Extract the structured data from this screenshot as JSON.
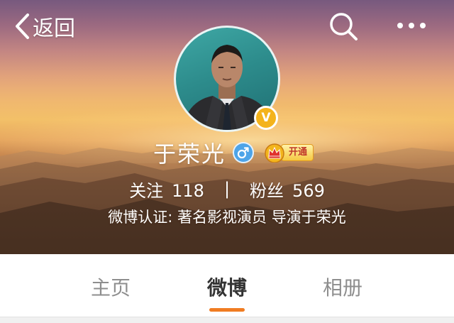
{
  "nav": {
    "back_label": "返回",
    "back_icon": "chevron-left-icon",
    "search_icon": "search-icon",
    "more_icon": "more-dots-icon"
  },
  "profile": {
    "name": "于荣光",
    "verified_mark": "V",
    "gender_icon": "male-icon",
    "vip_open_label": "开通",
    "following_label": "关注",
    "following_count": "118",
    "separator": "|",
    "followers_label": "粉丝",
    "followers_count": "569",
    "verification": "微博认证: 著名影视演员 导演于荣光"
  },
  "tabs": [
    {
      "label": "主页",
      "active": false
    },
    {
      "label": "微博",
      "active": true
    },
    {
      "label": "相册",
      "active": false
    }
  ],
  "colors": {
    "accent": "#f07c22",
    "verified_badge": "#f4b31c",
    "gender_badge": "#4da4e8",
    "tab_active": "#333333",
    "tab_inactive": "#8e8e8e"
  }
}
